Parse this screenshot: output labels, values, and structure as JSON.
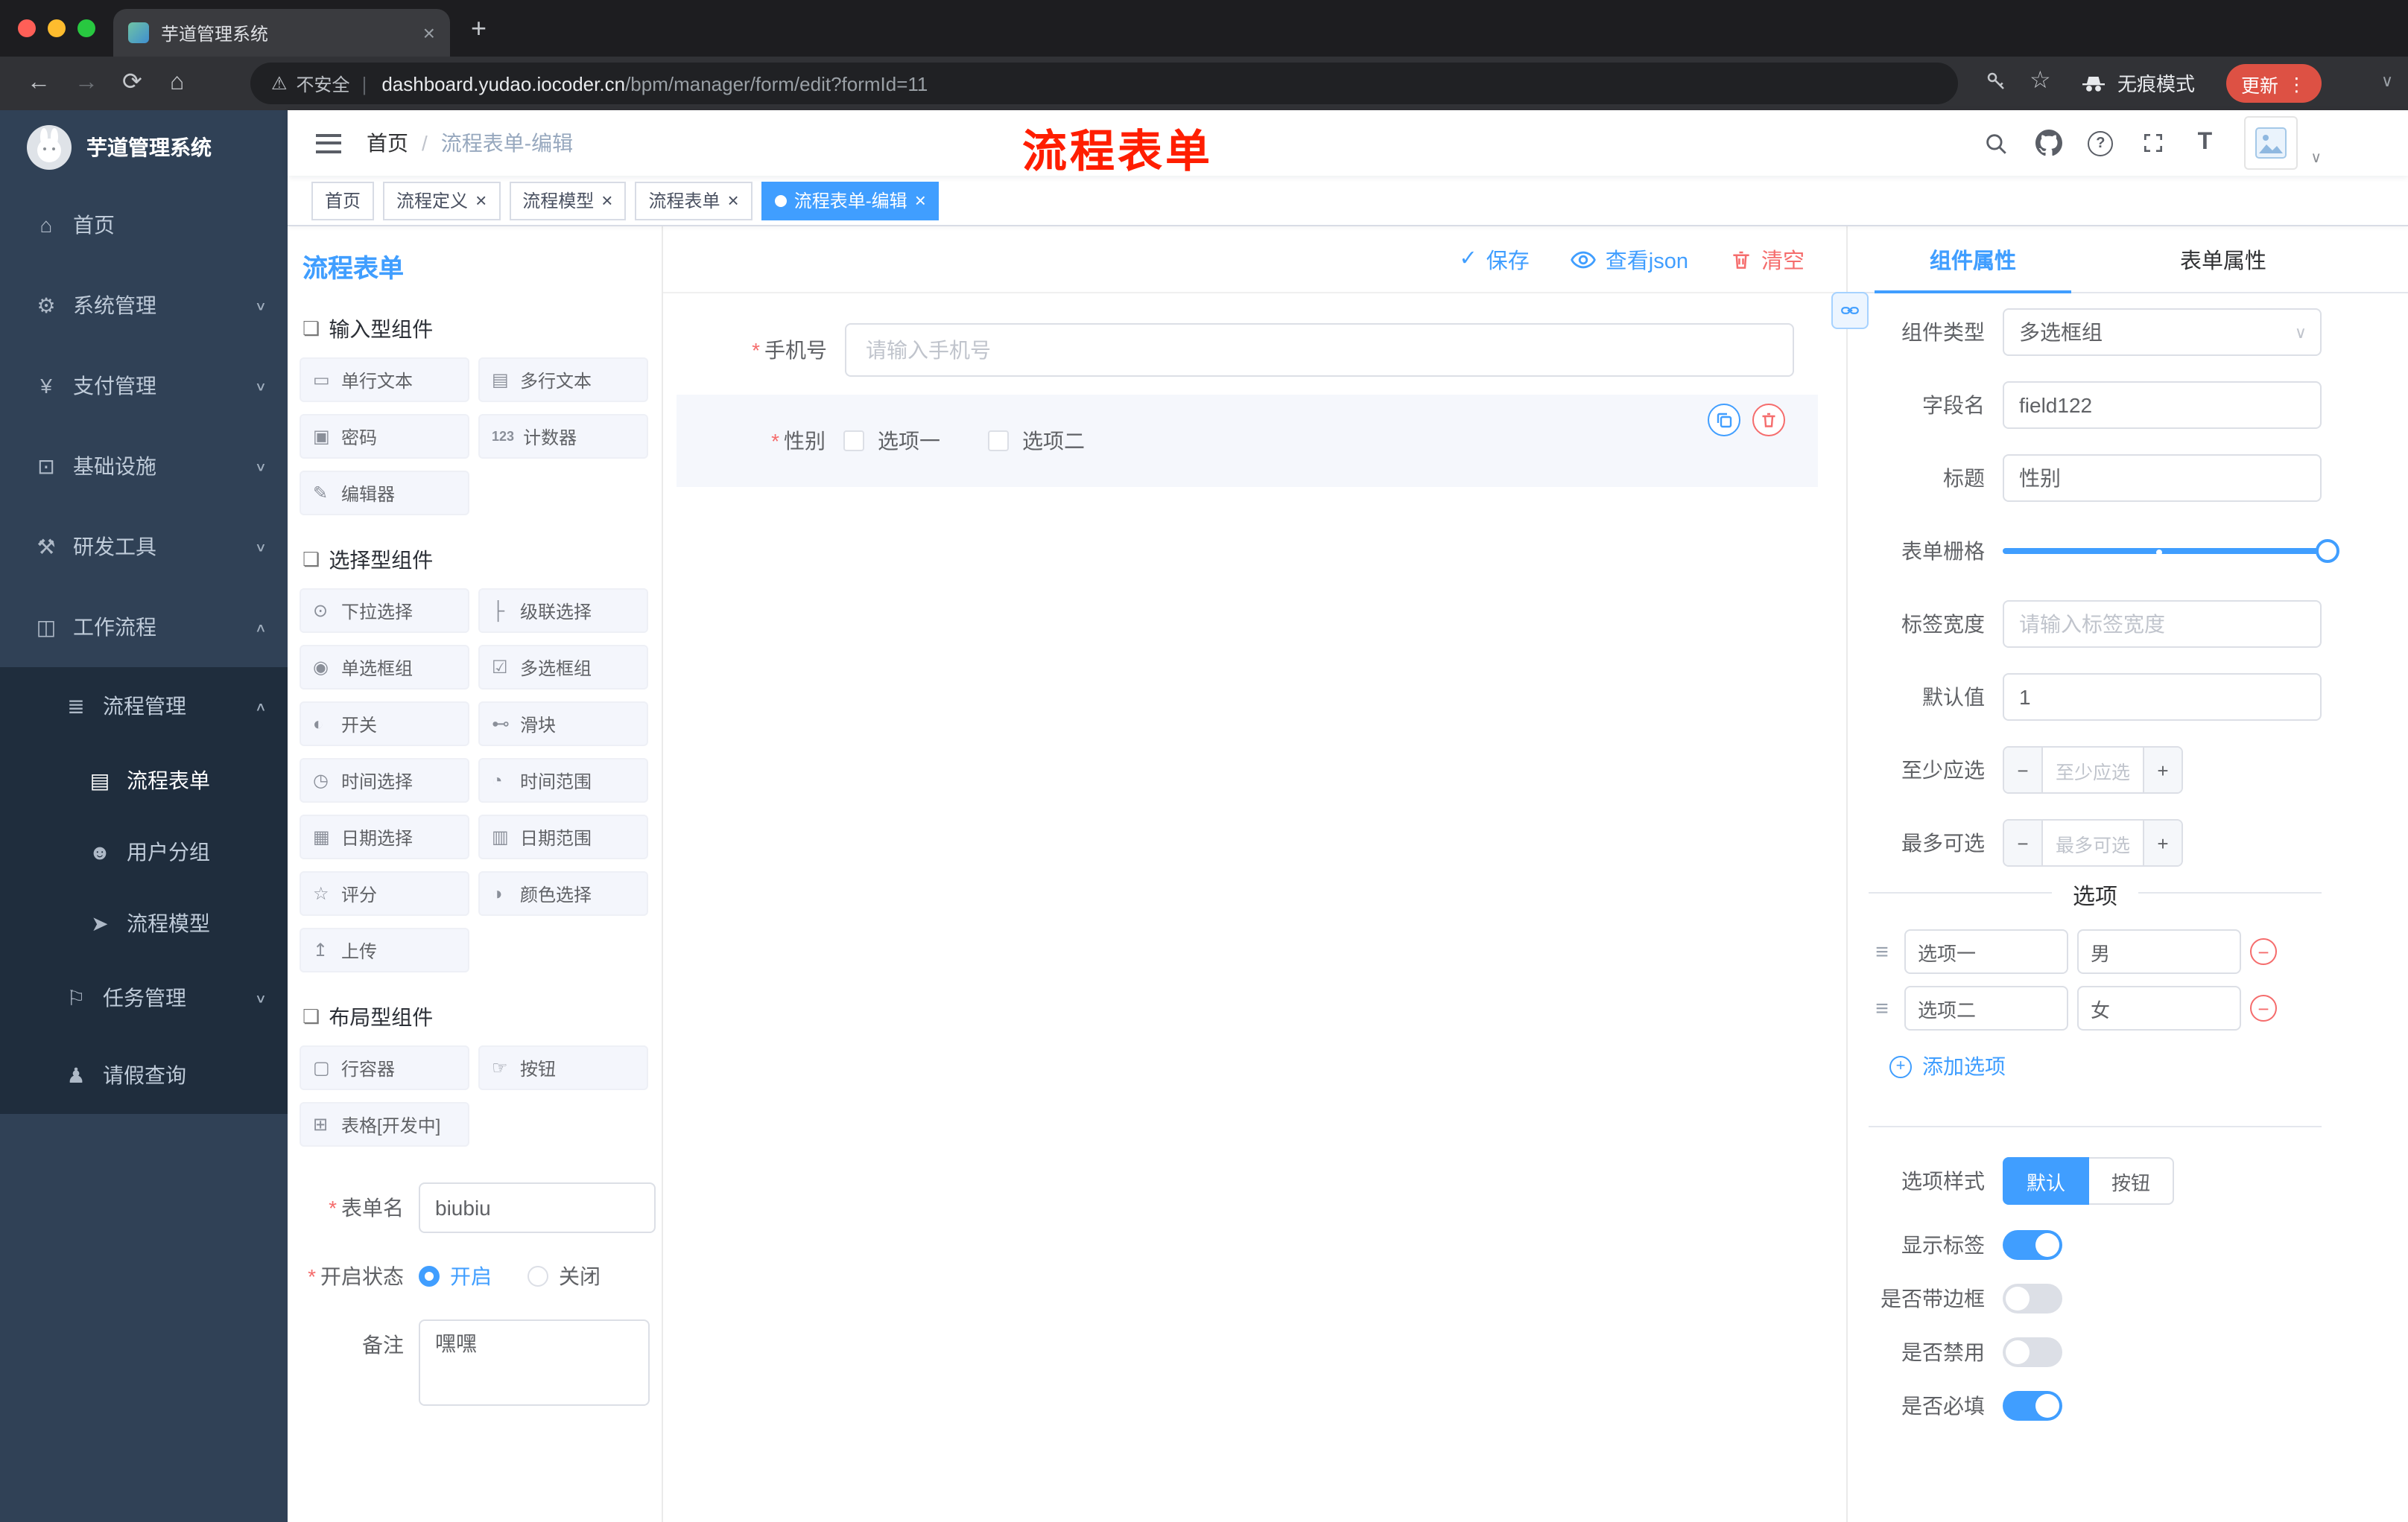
{
  "ui": {
    "required_marker": "*",
    "caret_down": "∨",
    "caret_up": "∧",
    "close_glyph": "×",
    "plus_glyph": "+",
    "minus_glyph": "−",
    "dots_glyph": "⋮",
    "pipe": "|",
    "drag_glyph": "≡",
    "check_glyph": "✓",
    "new_tab_glyph": "+",
    "colors": {
      "accent": "#409EFF",
      "danger": "#F56C6C",
      "sidebar": "#304156",
      "annotation": "#ff1e00"
    }
  },
  "browser": {
    "tab_title": "芋道管理系统",
    "back_glyph": "←",
    "forward_glyph": "→",
    "reload_glyph": "⟳",
    "home_glyph": "⌂",
    "warning_glyph": "⚠",
    "security_label": "不安全",
    "url_domain": "dashboard.yudao.iocoder.cn",
    "url_path": "/bpm/manager/form/edit?formId=11",
    "bookmark_glyph": "☆",
    "incognito_label": "无痕模式",
    "update_label": "更新"
  },
  "annotation": {
    "text": "流程表单"
  },
  "sidebar": {
    "logo_title": "芋道管理系统",
    "menu": [
      {
        "label": "首页",
        "icon": "⌂"
      },
      {
        "label": "系统管理",
        "icon": "⚙"
      },
      {
        "label": "支付管理",
        "icon": "¥"
      },
      {
        "label": "基础设施",
        "icon": "⊡"
      },
      {
        "label": "研发工具",
        "icon": "⚒"
      },
      {
        "label": "工作流程",
        "icon": "◫"
      },
      {
        "label": "流程管理",
        "icon": "≣"
      },
      {
        "label": "流程表单",
        "icon": "▤"
      },
      {
        "label": "用户分组",
        "icon": "☻"
      },
      {
        "label": "流程模型",
        "icon": "➤"
      },
      {
        "label": "任务管理",
        "icon": "⚐"
      },
      {
        "label": "请假查询",
        "icon": "♟"
      }
    ]
  },
  "header": {
    "breadcrumb_home": "首页",
    "breadcrumb_sep": "/",
    "breadcrumb_current": "流程表单-编辑",
    "help_glyph": "?",
    "fontsize_glyph": "T"
  },
  "tags": [
    {
      "label": "首页"
    },
    {
      "label": "流程定义"
    },
    {
      "label": "流程模型"
    },
    {
      "label": "流程表单"
    },
    {
      "label": "流程表单-编辑"
    }
  ],
  "palette": {
    "title": "流程表单",
    "section_icon": "❏",
    "groups": [
      {
        "name": "输入型组件",
        "items": [
          {
            "label": "单行文本",
            "icon": "▭"
          },
          {
            "label": "多行文本",
            "icon": "▤"
          },
          {
            "label": "密码",
            "icon": "▣"
          },
          {
            "label": "计数器",
            "icon": "123"
          },
          {
            "label": "编辑器",
            "icon": "✎"
          }
        ]
      },
      {
        "name": "选择型组件",
        "items": [
          {
            "label": "下拉选择",
            "icon": "⊙"
          },
          {
            "label": "级联选择",
            "icon": "├"
          },
          {
            "label": "单选框组",
            "icon": "◉"
          },
          {
            "label": "多选框组",
            "icon": "☑"
          },
          {
            "label": "开关",
            "icon": "◐"
          },
          {
            "label": "滑块",
            "icon": "⊷"
          },
          {
            "label": "时间选择",
            "icon": "◷"
          },
          {
            "label": "时间范围",
            "icon": "◔"
          },
          {
            "label": "日期选择",
            "icon": "▦"
          },
          {
            "label": "日期范围",
            "icon": "▥"
          },
          {
            "label": "评分",
            "icon": "☆"
          },
          {
            "label": "颜色选择",
            "icon": "◑"
          },
          {
            "label": "上传",
            "icon": "↥"
          }
        ]
      },
      {
        "name": "布局型组件",
        "items": [
          {
            "label": "行容器",
            "icon": "▢"
          },
          {
            "label": "按钮",
            "icon": "☞"
          },
          {
            "label": "表格[开发中]",
            "icon": "⊞"
          }
        ]
      }
    ],
    "form": {
      "name_label": "表单名",
      "name_value": "biubiu",
      "status_label": "开启状态",
      "status_on": "开启",
      "status_off": "关闭",
      "remark_label": "备注",
      "remark_value": "嘿嘿"
    }
  },
  "canvas": {
    "save_label": "保存",
    "view_json_label": "查看json",
    "clear_label": "清空",
    "phone": {
      "label": "手机号",
      "placeholder": "请输入手机号"
    },
    "gender": {
      "label": "性别",
      "options": [
        "选项一",
        "选项二"
      ]
    }
  },
  "props": {
    "tab_component": "组件属性",
    "tab_form": "表单属性",
    "rows": {
      "component_type": {
        "label": "组件类型",
        "value": "多选框组"
      },
      "field_name": {
        "label": "字段名",
        "value": "field122"
      },
      "title": {
        "label": "标题",
        "value": "性别"
      },
      "grid": {
        "label": "表单栅格"
      },
      "label_width": {
        "label": "标签宽度",
        "placeholder": "请输入标签宽度"
      },
      "default_value": {
        "label": "默认值",
        "value": "1"
      },
      "min_select": {
        "label": "至少应选",
        "placeholder": "至少应选"
      },
      "max_select": {
        "label": "最多可选",
        "placeholder": "最多可选"
      }
    },
    "options_title": "选项",
    "options": [
      {
        "label": "选项一",
        "value": "男"
      },
      {
        "label": "选项二",
        "value": "女"
      }
    ],
    "add_option_label": "添加选项",
    "option_style": {
      "label": "选项样式",
      "default": "默认",
      "button": "按钮"
    },
    "switches": [
      {
        "label": "显示标签",
        "on": true
      },
      {
        "label": "是否带边框",
        "on": false
      },
      {
        "label": "是否禁用",
        "on": false
      },
      {
        "label": "是否必填",
        "on": true
      }
    ]
  }
}
